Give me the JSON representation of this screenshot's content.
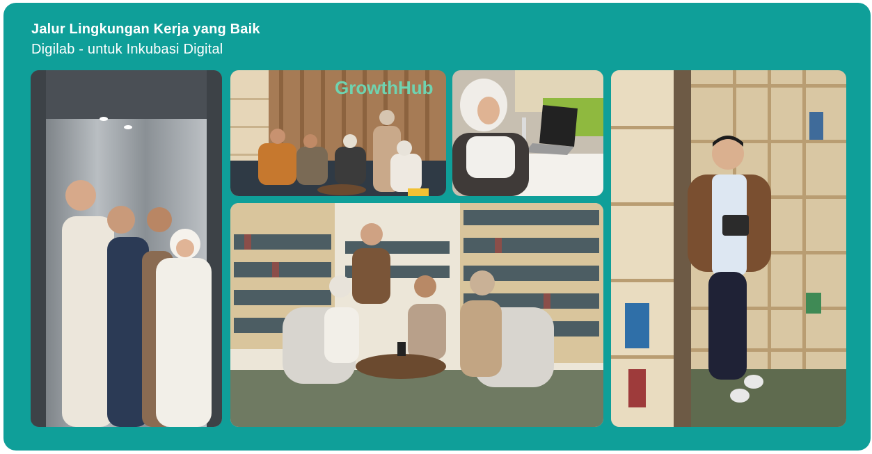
{
  "header": {
    "title": "Jalur Lingkungan Kerja yang Baik",
    "subtitle": "Digilab - untuk Inkubasi Digital"
  },
  "photos": {
    "lounge_sign_text": "GrowthHub"
  },
  "colors": {
    "card_background": "#0f9f99",
    "text": "#ffffff"
  }
}
